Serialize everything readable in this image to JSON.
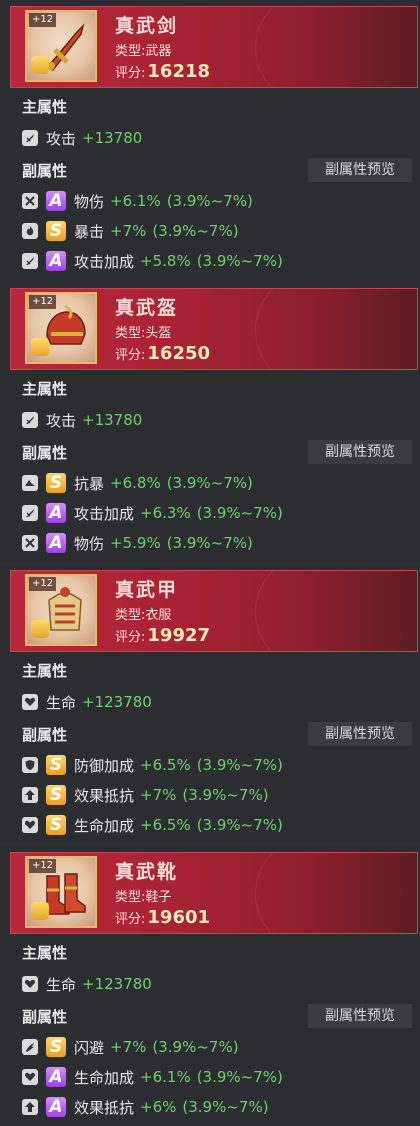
{
  "labels": {
    "main_attr": "主属性",
    "sub_attr": "副属性",
    "preview": "副属性预览",
    "type_prefix": "类型:",
    "score_prefix": "评分:"
  },
  "colors": {
    "header": "#b8283a",
    "value_green": "#6fcf6f",
    "grade_s": "#f0b030",
    "grade_a": "#b060f0"
  },
  "cards": [
    {
      "level": "+12",
      "name": "真武剑",
      "type": "武器",
      "score": "16218",
      "main": {
        "icon": "attack-icon",
        "name": "攻击",
        "value": "+13780"
      },
      "subs": [
        {
          "icon": "crossed-swords-icon",
          "grade": "A",
          "name": "物伤",
          "value": "+6.1%",
          "range": "(3.9%~7%)"
        },
        {
          "icon": "flame-icon",
          "grade": "S",
          "name": "暴击",
          "value": "+7%",
          "range": "(3.9%~7%)"
        },
        {
          "icon": "attack-icon",
          "grade": "A",
          "name": "攻击加成",
          "value": "+5.8%",
          "range": "(3.9%~7%)"
        }
      ]
    },
    {
      "level": "+12",
      "name": "真武盔",
      "type": "头盔",
      "score": "16250",
      "main": {
        "icon": "attack-icon",
        "name": "攻击",
        "value": "+13780"
      },
      "subs": [
        {
          "icon": "resist-icon",
          "grade": "S",
          "name": "抗暴",
          "value": "+6.8%",
          "range": "(3.9%~7%)"
        },
        {
          "icon": "attack-icon",
          "grade": "A",
          "name": "攻击加成",
          "value": "+6.3%",
          "range": "(3.9%~7%)"
        },
        {
          "icon": "crossed-swords-icon",
          "grade": "A",
          "name": "物伤",
          "value": "+5.9%",
          "range": "(3.9%~7%)"
        }
      ]
    },
    {
      "level": "+12",
      "name": "真武甲",
      "type": "衣服",
      "score": "19927",
      "main": {
        "icon": "heart-icon",
        "name": "生命",
        "value": "+123780"
      },
      "subs": [
        {
          "icon": "shield-icon",
          "grade": "S",
          "name": "防御加成",
          "value": "+6.5%",
          "range": "(3.9%~7%)"
        },
        {
          "icon": "arrow-up-icon",
          "grade": "S",
          "name": "效果抵抗",
          "value": "+7%",
          "range": "(3.9%~7%)"
        },
        {
          "icon": "heart-icon",
          "grade": "S",
          "name": "生命加成",
          "value": "+6.5%",
          "range": "(3.9%~7%)"
        }
      ]
    },
    {
      "level": "+12",
      "name": "真武靴",
      "type": "鞋子",
      "score": "19601",
      "main": {
        "icon": "heart-icon",
        "name": "生命",
        "value": "+123780"
      },
      "subs": [
        {
          "icon": "dodge-icon",
          "grade": "S",
          "name": "闪避",
          "value": "+7%",
          "range": "(3.9%~7%)"
        },
        {
          "icon": "heart-icon",
          "grade": "A",
          "name": "生命加成",
          "value": "+6.1%",
          "range": "(3.9%~7%)"
        },
        {
          "icon": "arrow-up-icon",
          "grade": "A",
          "name": "效果抵抗",
          "value": "+6%",
          "range": "(3.9%~7%)"
        }
      ]
    }
  ]
}
